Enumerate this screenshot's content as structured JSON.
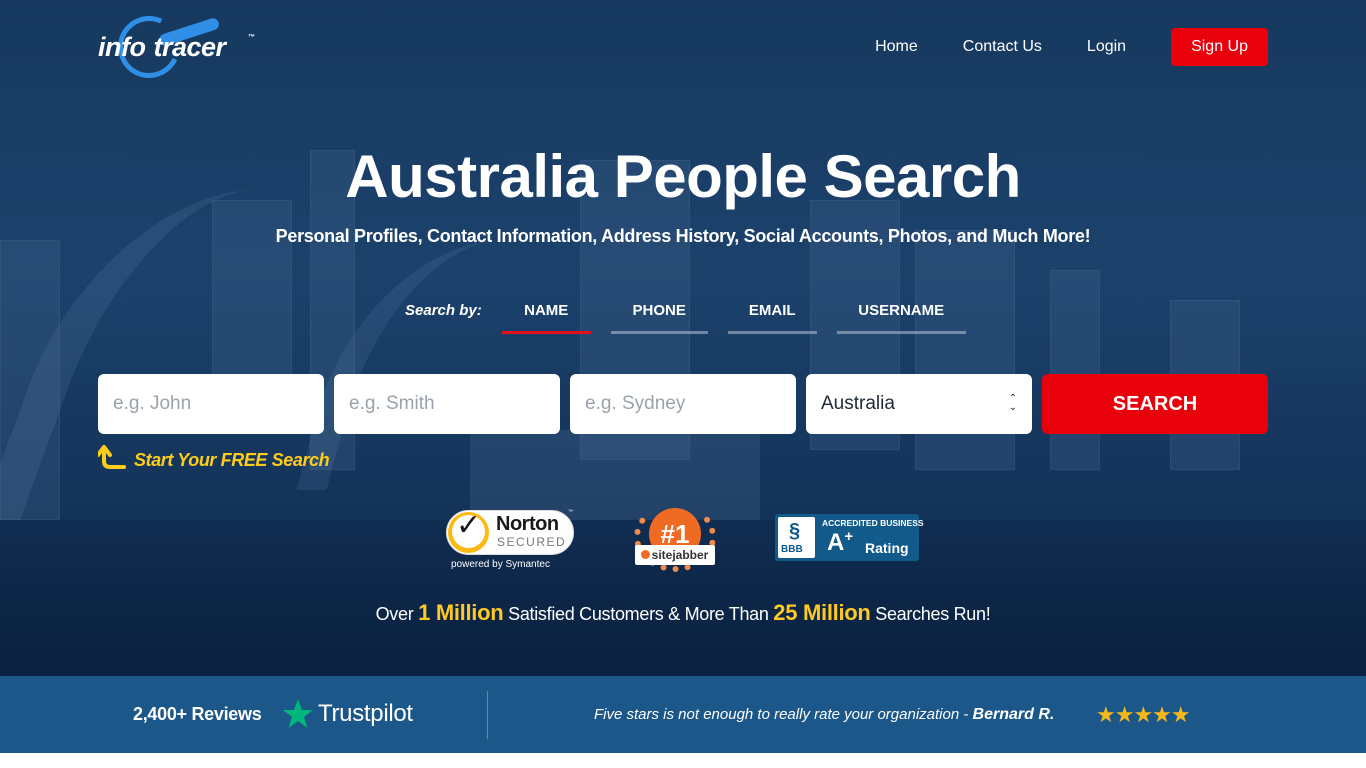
{
  "brand": {
    "logo_left": "info",
    "logo_right": "tracer",
    "trademark": "™"
  },
  "nav": {
    "items": [
      {
        "label": "Home"
      },
      {
        "label": "Contact Us"
      },
      {
        "label": "Login"
      }
    ],
    "signup_label": "Sign Up"
  },
  "hero": {
    "title": "Australia People Search",
    "subtitle": "Personal Profiles, Contact Information, Address History, Social Accounts, Photos, and Much More!"
  },
  "search_by": {
    "label": "Search by:",
    "tabs": [
      {
        "label": "NAME",
        "active": true
      },
      {
        "label": "PHONE",
        "active": false
      },
      {
        "label": "EMAIL",
        "active": false
      },
      {
        "label": "USERNAME",
        "active": false
      }
    ]
  },
  "form": {
    "first_name_placeholder": "e.g. John",
    "last_name_placeholder": "e.g. Smith",
    "city_placeholder": "e.g. Sydney",
    "country_value": "Australia",
    "search_label": "SEARCH",
    "free_search_text": "Start Your FREE Search"
  },
  "badges": {
    "norton": {
      "name": "Norton",
      "secured": "SECURED",
      "powered_by": "powered by Symantec",
      "tm": "™"
    },
    "sitejabber": {
      "rank": "#1",
      "name": "sitejabber"
    },
    "bbb": {
      "accredited": "ACCREDITED BUSINESS",
      "grade": "A",
      "grade_plus": "+",
      "rating": "Rating",
      "letters": "BBB"
    }
  },
  "stats": {
    "prefix": "Over",
    "customers_count": "1 Million",
    "middle": "Satisfied Customers & More Than",
    "searches_count": "25 Million",
    "suffix": "Searches Run!"
  },
  "trustbar": {
    "reviews": "2,400+ Reviews",
    "trustpilot": "Trustpilot",
    "quote": "Five stars is not enough to really rate your organization -",
    "author": "Bernard R.",
    "stars": "★★★★★",
    "rating": 5
  },
  "colors": {
    "accent_red": "#e8000b",
    "highlight_yellow": "#ffc824",
    "trustbar_blue": "#1c5789",
    "trustpilot_green": "#00b67a",
    "star_gold": "#f5b71a"
  }
}
